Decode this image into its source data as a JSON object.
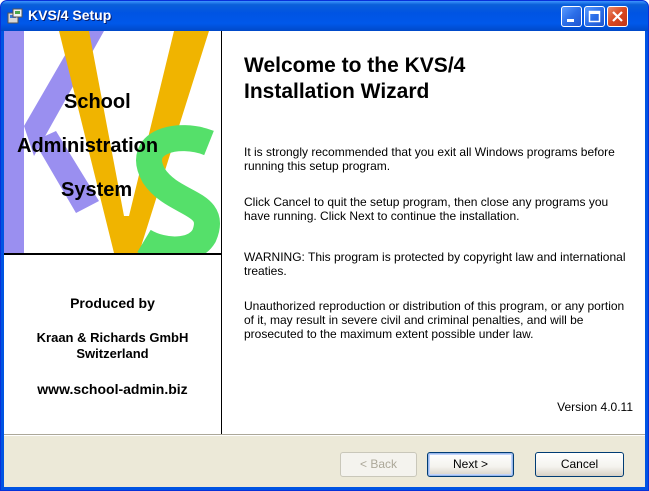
{
  "window": {
    "title": "KVS/4 Setup",
    "controls": {
      "minimize": "minimize-icon",
      "maximize": "maximize-icon",
      "close": "close-icon"
    }
  },
  "sidebar": {
    "logo_lines": [
      "School",
      "Administration",
      "System"
    ],
    "produced_by": "Produced by",
    "company": "Kraan & Richards GmbH",
    "country": "Switzerland",
    "website": "www.school-admin.biz",
    "logo_colors": {
      "k": "#9a8ff0",
      "v": "#f0b400",
      "s": "#55e06a"
    }
  },
  "main": {
    "heading_line1": "Welcome to the KVS/4",
    "heading_line2": "Installation Wizard",
    "paragraphs": [
      "It is strongly recommended that you exit all Windows programs before running this setup program.",
      "Click Cancel to quit the setup program, then close any programs you have running.  Click Next to continue the installation.",
      "WARNING: This program is protected by copyright law and international treaties.",
      "Unauthorized reproduction or distribution of this program, or any portion of it, may result in severe civil and criminal penalties, and will be prosecuted to the maximum extent possible under law."
    ],
    "version": "Version 4.0.11"
  },
  "buttons": {
    "back": "< Back",
    "next": "Next >",
    "cancel": "Cancel"
  }
}
